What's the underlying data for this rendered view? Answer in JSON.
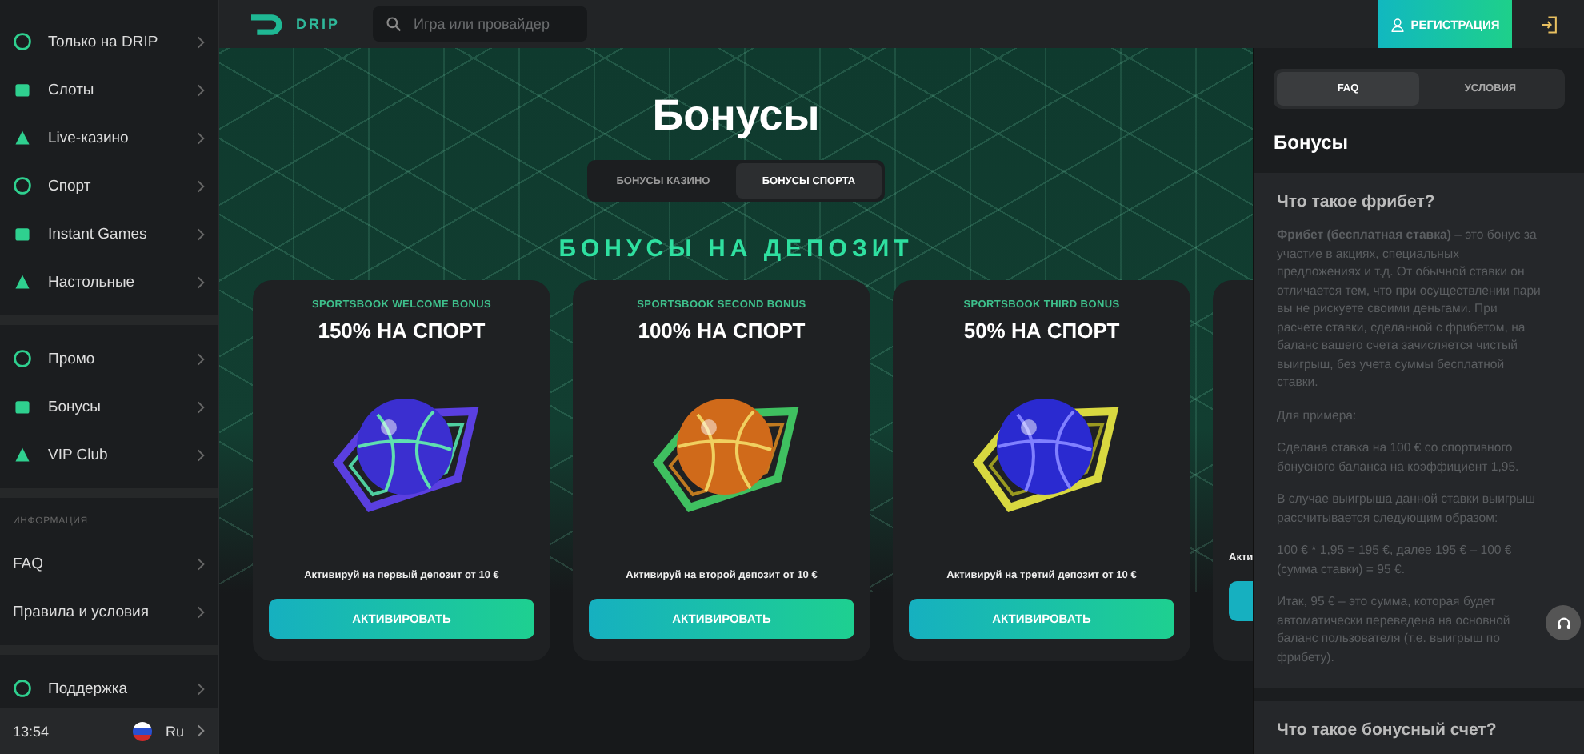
{
  "sidebar": {
    "groups": [
      {
        "items": [
          {
            "label": "Только на DRIP"
          },
          {
            "label": "Слоты"
          },
          {
            "label": "Live-казино"
          },
          {
            "label": "Спорт"
          },
          {
            "label": "Instant Games"
          },
          {
            "label": "Настольные"
          }
        ]
      },
      {
        "items": [
          {
            "label": "Промо"
          },
          {
            "label": "Бонусы"
          },
          {
            "label": "VIP Club"
          }
        ]
      },
      {
        "heading": "ИНФОРМАЦИЯ",
        "items": [
          {
            "label": "FAQ"
          },
          {
            "label": "Правила и условия"
          }
        ]
      },
      {
        "items": [
          {
            "label": "Поддержка"
          }
        ]
      }
    ],
    "footer": {
      "time": "13:54",
      "language": "Ru"
    }
  },
  "header": {
    "logo": "DRIP",
    "search": {
      "placeholder": "Игра или провайдер"
    },
    "register": "РЕГИСТРАЦИЯ"
  },
  "page": {
    "title": "Бонусы",
    "tabs": [
      {
        "label": "БОНУСЫ КАЗИНО",
        "selected": false
      },
      {
        "label": "БОНУСЫ СПОРТА",
        "selected": true
      }
    ],
    "section": "БОНУСЫ НА ДЕПОЗИТ",
    "cards": [
      {
        "kind": "full",
        "subtitle": "SPORTSBOOK WELCOME BONUS",
        "title": "150% НА СПОРТ",
        "description": "Активируй на первый депозит от 10 €",
        "button": "АКТИВИРОВАТЬ"
      },
      {
        "kind": "full",
        "subtitle": "SPORTSBOOK SECOND BONUS",
        "title": "100% НА СПОРТ",
        "description": "Активируй на второй депозит от 10 €",
        "button": "АКТИВИРОВАТЬ"
      },
      {
        "kind": "full",
        "subtitle": "SPORTSBOOK THIRD BONUS",
        "title": "50% НА СПОРТ",
        "description": "Активируй на третий депозит от 10 €",
        "button": "АКТИВИРОВАТЬ"
      },
      {
        "kind": "partial",
        "description": "Акти"
      }
    ]
  },
  "panel": {
    "tabs": [
      {
        "label": "FAQ",
        "selected": true
      },
      {
        "label": "УСЛОВИЯ",
        "selected": false
      }
    ],
    "title": "Бонусы",
    "sections": [
      {
        "question": "Что такое фрибет?",
        "paragraphs": [
          "**Фрибет (бесплатная ставка)** – это бонус за участие в акциях, специальных предложениях и т.д. От обычной ставки он отличается тем, что при осуществлении пари вы не рискуете своими деньгами. При расчете ставки, сделанной с фрибетом, на баланс вашего счета зачисляется чистый выигрыш, без учета суммы бесплатной ставки.",
          "Для примера:",
          "Сделана ставка на 100 € со спортивного бонусного баланса на коэффициент 1,95.",
          "В случае выигрыша данной ставки выигрыш рассчитывается следующим образом:",
          "100 € * 1,95 = 195 €, далее 195 € – 100 € (сумма ставки) = 95 €.",
          "Итак, 95 € – это сумма, которая будет автоматически переведена на основной баланс пользователя (т.е. выигрыш по фрибету)."
        ]
      },
      {
        "question": "Что такое бонусный счет?"
      }
    ]
  }
}
